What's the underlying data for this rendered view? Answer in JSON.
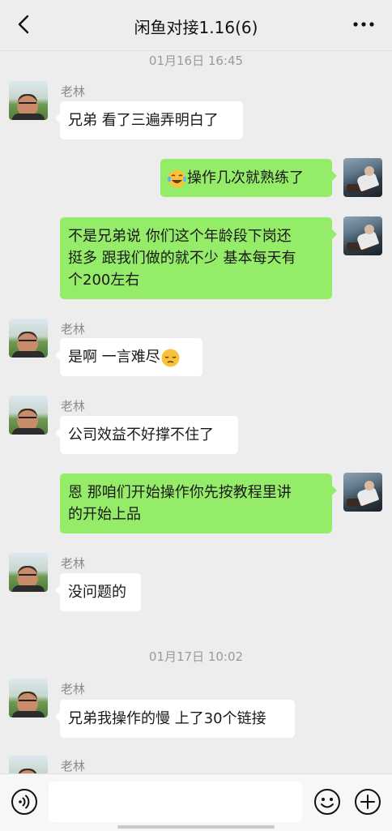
{
  "header": {
    "title": "闲鱼对接1.16(6)"
  },
  "messages": {
    "time1": "01月16日 16:45",
    "m1_sender": "老林",
    "m1_text": "兄弟 看了三遍弄明白了",
    "m2_text": "操作几次就熟练了",
    "m3_line1": "不是兄弟说 你们这个年龄段下岗还",
    "m3_line2": "挺多 跟我们做的就不少 基本每天有",
    "m3_line3": "个200左右",
    "m4_sender": "老林",
    "m4_text": "是啊 一言难尽",
    "m5_sender": "老林",
    "m5_text": "公司效益不好撑不住了",
    "m6_line1": "恩 那咱们开始操作你先按教程里讲",
    "m6_line2": "的开始上品",
    "m7_sender": "老林",
    "m7_text": "没问题的",
    "time2": "01月17日 10:02",
    "m8_sender": "老林",
    "m8_text": "兄弟我操作的慢 上了30个链接",
    "m9_sender": "老林"
  },
  "icons": {
    "back": "chevron-left-icon",
    "more": "more-icon",
    "voice": "voice-icon",
    "emoji": "emoji-icon",
    "add": "plus-icon"
  },
  "colors": {
    "outgoing_bubble": "#95ec69",
    "incoming_bubble": "#ffffff",
    "background": "#ededed"
  }
}
